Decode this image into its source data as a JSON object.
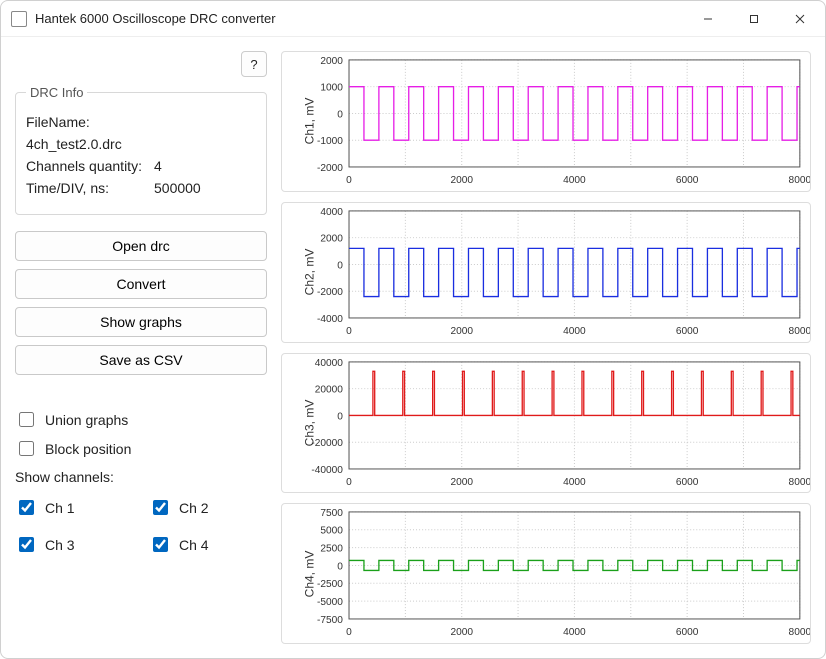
{
  "window": {
    "title": "Hantek 6000 Oscilloscope DRC converter"
  },
  "help_button": "?",
  "drc_info": {
    "legend": "DRC Info",
    "filename_label": "FileName:",
    "filename": "4ch_test2.0.drc",
    "channels_label": "Channels quantity:",
    "channels": "4",
    "timediv_label": "Time/DIV, ns:",
    "timediv": "500000"
  },
  "buttons": {
    "open": "Open drc",
    "convert": "Convert",
    "show_graphs": "Show graphs",
    "save_csv": "Save as CSV"
  },
  "options": {
    "union_graphs": {
      "label": "Union graphs",
      "checked": false
    },
    "block_position": {
      "label": "Block position",
      "checked": false
    }
  },
  "show_channels_label": "Show channels:",
  "channels_show": {
    "ch1": {
      "label": "Ch 1",
      "checked": true
    },
    "ch2": {
      "label": "Ch 2",
      "checked": true
    },
    "ch3": {
      "label": "Ch 3",
      "checked": true
    },
    "ch4": {
      "label": "Ch 4",
      "checked": true
    }
  },
  "chart_data": [
    {
      "type": "line",
      "ylabel": "Ch1, mV",
      "color": "#e61ee6",
      "xlim": [
        0,
        8000
      ],
      "ylim": [
        -2000,
        2000
      ],
      "yticks": [
        -2000,
        -1000,
        0,
        1000,
        2000
      ],
      "xticks": [
        0,
        2000,
        4000,
        6000,
        8000
      ],
      "wave": "square",
      "period_x": 530,
      "high": 1000,
      "low": -1000
    },
    {
      "type": "line",
      "ylabel": "Ch2, mV",
      "color": "#1a2ee0",
      "xlim": [
        0,
        8000
      ],
      "ylim": [
        -4000,
        4000
      ],
      "yticks": [
        -4000,
        -2000,
        0,
        2000,
        4000
      ],
      "xticks": [
        0,
        2000,
        4000,
        6000,
        8000
      ],
      "wave": "square",
      "period_x": 530,
      "high": 1200,
      "low": -2400
    },
    {
      "type": "line",
      "ylabel": "Ch3, mV",
      "color": "#e01a1a",
      "xlim": [
        0,
        8000
      ],
      "ylim": [
        -40000,
        40000
      ],
      "yticks": [
        -40000,
        -20000,
        0,
        20000,
        40000
      ],
      "xticks": [
        0,
        2000,
        4000,
        6000,
        8000
      ],
      "wave": "spikes",
      "period_x": 530,
      "high": 33000,
      "low": 0
    },
    {
      "type": "line",
      "ylabel": "Ch4, mV",
      "color": "#1aa01a",
      "xlim": [
        0,
        8000
      ],
      "ylim": [
        -7500,
        7500
      ],
      "yticks": [
        -7500,
        -5000,
        -2500,
        0,
        2500,
        5000,
        7500
      ],
      "xticks": [
        0,
        2000,
        4000,
        6000,
        8000
      ],
      "wave": "square",
      "period_x": 530,
      "high": 700,
      "low": -700
    }
  ]
}
